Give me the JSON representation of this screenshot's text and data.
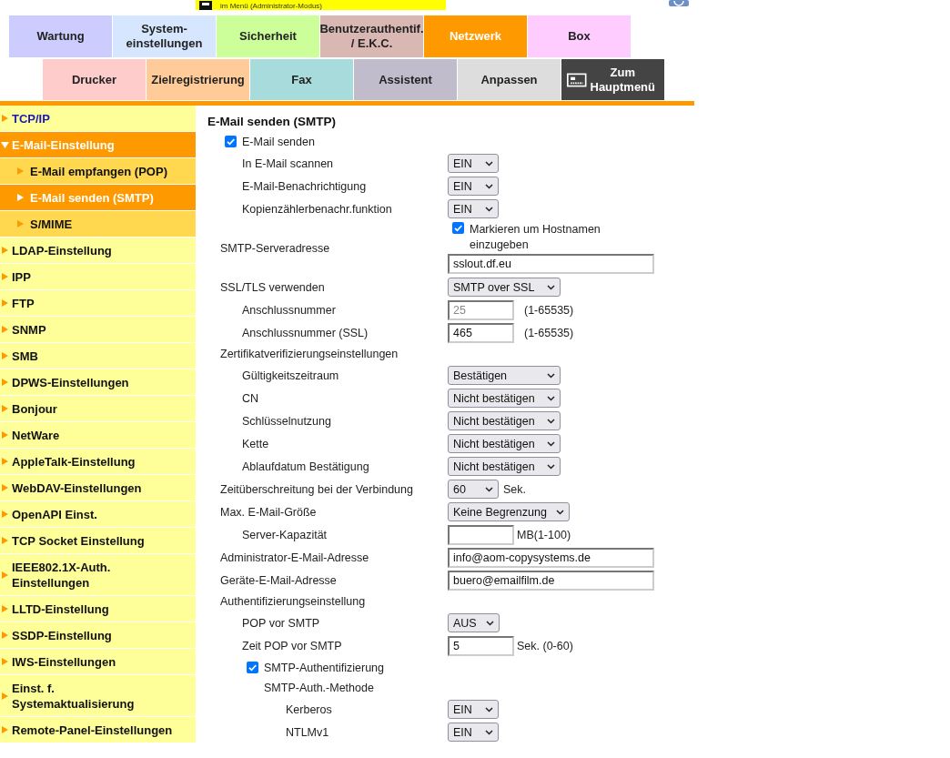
{
  "banner": {
    "text": "im Menü (Administrator-Modus)"
  },
  "tabs_top": [
    {
      "label": "Wartung",
      "color": "#ccccff",
      "selected": false
    },
    {
      "label": "System-\neinstellungen",
      "color": "#d6e6ff",
      "selected": false
    },
    {
      "label": "Sicherheit",
      "color": "#ccff99",
      "selected": false
    },
    {
      "label": "Benutzerauthentif.\n/ E.K.C.",
      "color": "#d9b8b3",
      "selected": false
    },
    {
      "label": "Netzwerk",
      "color": "#ff9900",
      "selected": true
    },
    {
      "label": "Box",
      "color": "#ffccff",
      "selected": false
    }
  ],
  "tabs_bottom": [
    {
      "kind": "tab",
      "label": "Drucker",
      "color": "#ffcccc",
      "selected": false
    },
    {
      "kind": "tab",
      "label": "Zielregistrierung",
      "color": "#ffcc99",
      "selected": false
    },
    {
      "kind": "tab",
      "label": "Fax",
      "color": "#a8dcdc",
      "selected": false
    },
    {
      "kind": "tab",
      "label": "Assistent",
      "color": "#c0bccc",
      "selected": false
    },
    {
      "kind": "tab",
      "label": "Anpassen",
      "color": "#dddddd",
      "selected": false
    },
    {
      "kind": "home",
      "label": "Zum\nHauptmenü",
      "color": "#444444"
    }
  ],
  "sidebar": {
    "items": [
      {
        "label": "TCP/IP",
        "visited": true,
        "selected": false,
        "expanded": false
      },
      {
        "label": "E-Mail-Einstellung",
        "visited": false,
        "selected": true,
        "expanded": true,
        "children": [
          {
            "label": "E-Mail empfangen (POP)",
            "selected": false
          },
          {
            "label": "E-Mail senden (SMTP)",
            "selected": true
          },
          {
            "label": "S/MIME",
            "selected": false
          }
        ]
      },
      {
        "label": "LDAP-Einstellung",
        "visited": false,
        "selected": false,
        "expanded": false
      },
      {
        "label": "IPP",
        "visited": false,
        "selected": false,
        "expanded": false
      },
      {
        "label": "FTP",
        "visited": false,
        "selected": false,
        "expanded": false
      },
      {
        "label": "SNMP",
        "visited": false,
        "selected": false,
        "expanded": false
      },
      {
        "label": "SMB",
        "visited": false,
        "selected": false,
        "expanded": false
      },
      {
        "label": "DPWS-Einstellungen",
        "visited": false,
        "selected": false,
        "expanded": false
      },
      {
        "label": "Bonjour",
        "visited": false,
        "selected": false,
        "expanded": false
      },
      {
        "label": "NetWare",
        "visited": false,
        "selected": false,
        "expanded": false
      },
      {
        "label": "AppleTalk-Einstellung",
        "visited": false,
        "selected": false,
        "expanded": false
      },
      {
        "label": "WebDAV-Einstellungen",
        "visited": false,
        "selected": false,
        "expanded": false
      },
      {
        "label": "OpenAPI Einst.",
        "visited": false,
        "selected": false,
        "expanded": false
      },
      {
        "label": "TCP Socket Einstellung",
        "visited": false,
        "selected": false,
        "expanded": false
      },
      {
        "label": "IEEE802.1X-Auth.\nEinstellungen",
        "visited": false,
        "selected": false,
        "expanded": false
      },
      {
        "label": "LLTD-Einstellung",
        "visited": false,
        "selected": false,
        "expanded": false
      },
      {
        "label": "SSDP-Einstellung",
        "visited": false,
        "selected": false,
        "expanded": false
      },
      {
        "label": "IWS-Einstellungen",
        "visited": false,
        "selected": false,
        "expanded": false
      },
      {
        "label": "Einst. f.\nSystemaktualisierung",
        "visited": false,
        "selected": false,
        "expanded": false
      },
      {
        "label": "Remote-Panel-Einstellungen",
        "visited": false,
        "selected": false,
        "expanded": false
      }
    ]
  },
  "form": {
    "title": "E-Mail senden (SMTP)",
    "rows": [
      {
        "kind": "checkbox",
        "label": "E-Mail senden",
        "checked": true,
        "children": [
          {
            "kind": "select",
            "label": "In E-Mail scannen",
            "value": "EIN"
          },
          {
            "kind": "select",
            "label": "E-Mail-Benachrichtigung",
            "value": "EIN"
          },
          {
            "kind": "select",
            "label": "Kopienzählerbenachr.funktion",
            "value": "EIN"
          }
        ]
      },
      {
        "kind": "host",
        "label": "SMTP-Serveradresse",
        "option": "Markieren um Hostnamen einzugeben",
        "checked": true,
        "value": "sslout.df.eu"
      },
      {
        "kind": "select",
        "label": "SSL/TLS verwenden",
        "value": "SMTP over SSL",
        "children": [
          {
            "kind": "number",
            "label": "Anschlussnummer",
            "value": "25",
            "disabled": true,
            "suffix": "(1-65535)"
          },
          {
            "kind": "number",
            "label": "Anschlussnummer (SSL)",
            "value": "465",
            "disabled": false,
            "suffix": "(1-65535)"
          }
        ]
      },
      {
        "kind": "heading",
        "label": "Zertifikatverifizierungseinstellungen",
        "children": [
          {
            "kind": "select",
            "label": "Gültigkeitszeitraum",
            "value": "Bestätigen"
          },
          {
            "kind": "select",
            "label": "CN",
            "value": "Nicht bestätigen"
          },
          {
            "kind": "select",
            "label": "Schlüsselnutzung",
            "value": "Nicht bestätigen"
          },
          {
            "kind": "select",
            "label": "Kette",
            "value": "Nicht bestätigen"
          },
          {
            "kind": "select",
            "label": "Ablaufdatum Bestätigung",
            "value": "Nicht bestätigen"
          }
        ]
      },
      {
        "kind": "select",
        "label": "Zeitüberschreitung bei der Verbindung",
        "value": "60",
        "suffix": "Sek."
      },
      {
        "kind": "select",
        "label": "Max. E-Mail-Größe",
        "value": "Keine Begrenzung",
        "children": [
          {
            "kind": "number",
            "label": "Server-Kapazität",
            "suffix": "MB(1-100)"
          }
        ]
      },
      {
        "kind": "text",
        "label": "Administrator-E-Mail-Adresse",
        "value": "info@aom-copysystems.de"
      },
      {
        "kind": "text",
        "label": "Geräte-E-Mail-Adresse",
        "value": "buero@emailfilm.de"
      },
      {
        "kind": "heading",
        "label": "Authentifizierungseinstellung",
        "children": [
          {
            "kind": "select",
            "label": "POP vor SMTP",
            "value": "AUS"
          },
          {
            "kind": "number",
            "label": "Zeit POP vor SMTP",
            "value": "5",
            "disabled": false,
            "suffix": "Sek. (0-60)"
          },
          {
            "kind": "checkbox",
            "label": "SMTP-Authentifizierung",
            "checked": true,
            "children": [
              {
                "kind": "heading",
                "label": "SMTP-Auth.-Methode",
                "children": [
                  {
                    "kind": "select",
                    "label": "Kerberos",
                    "value": "EIN"
                  },
                  {
                    "kind": "select",
                    "label": "NTLMv1",
                    "value": "EIN"
                  }
                ]
              }
            ]
          }
        ]
      }
    ]
  }
}
